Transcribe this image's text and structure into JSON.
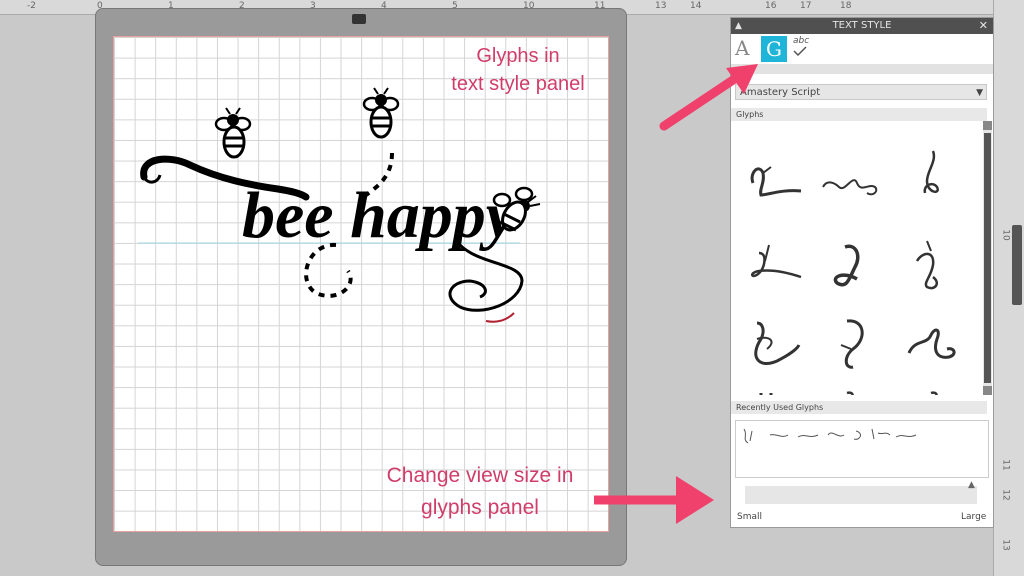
{
  "annotations": {
    "glyphs_line1": "Glyphs in",
    "glyphs_line2": "text style panel",
    "view_line1": "Change view size in",
    "view_line2": "glyphs panel"
  },
  "canvas": {
    "design_text": "bee happy"
  },
  "panel": {
    "title": "TEXT STYLE",
    "tab_text": "A",
    "tab_glyphs": "G",
    "tab_spell": "abc",
    "font_name": "Amastery Script",
    "glyphs_header": "Glyphs",
    "recent_header": "Recently Used Glyphs",
    "slider_min": "Small",
    "slider_max": "Large"
  },
  "colors": {
    "accent_tab": "#1fb5d8",
    "annotation": "#d13d6b",
    "arrow": "#f0416c"
  }
}
